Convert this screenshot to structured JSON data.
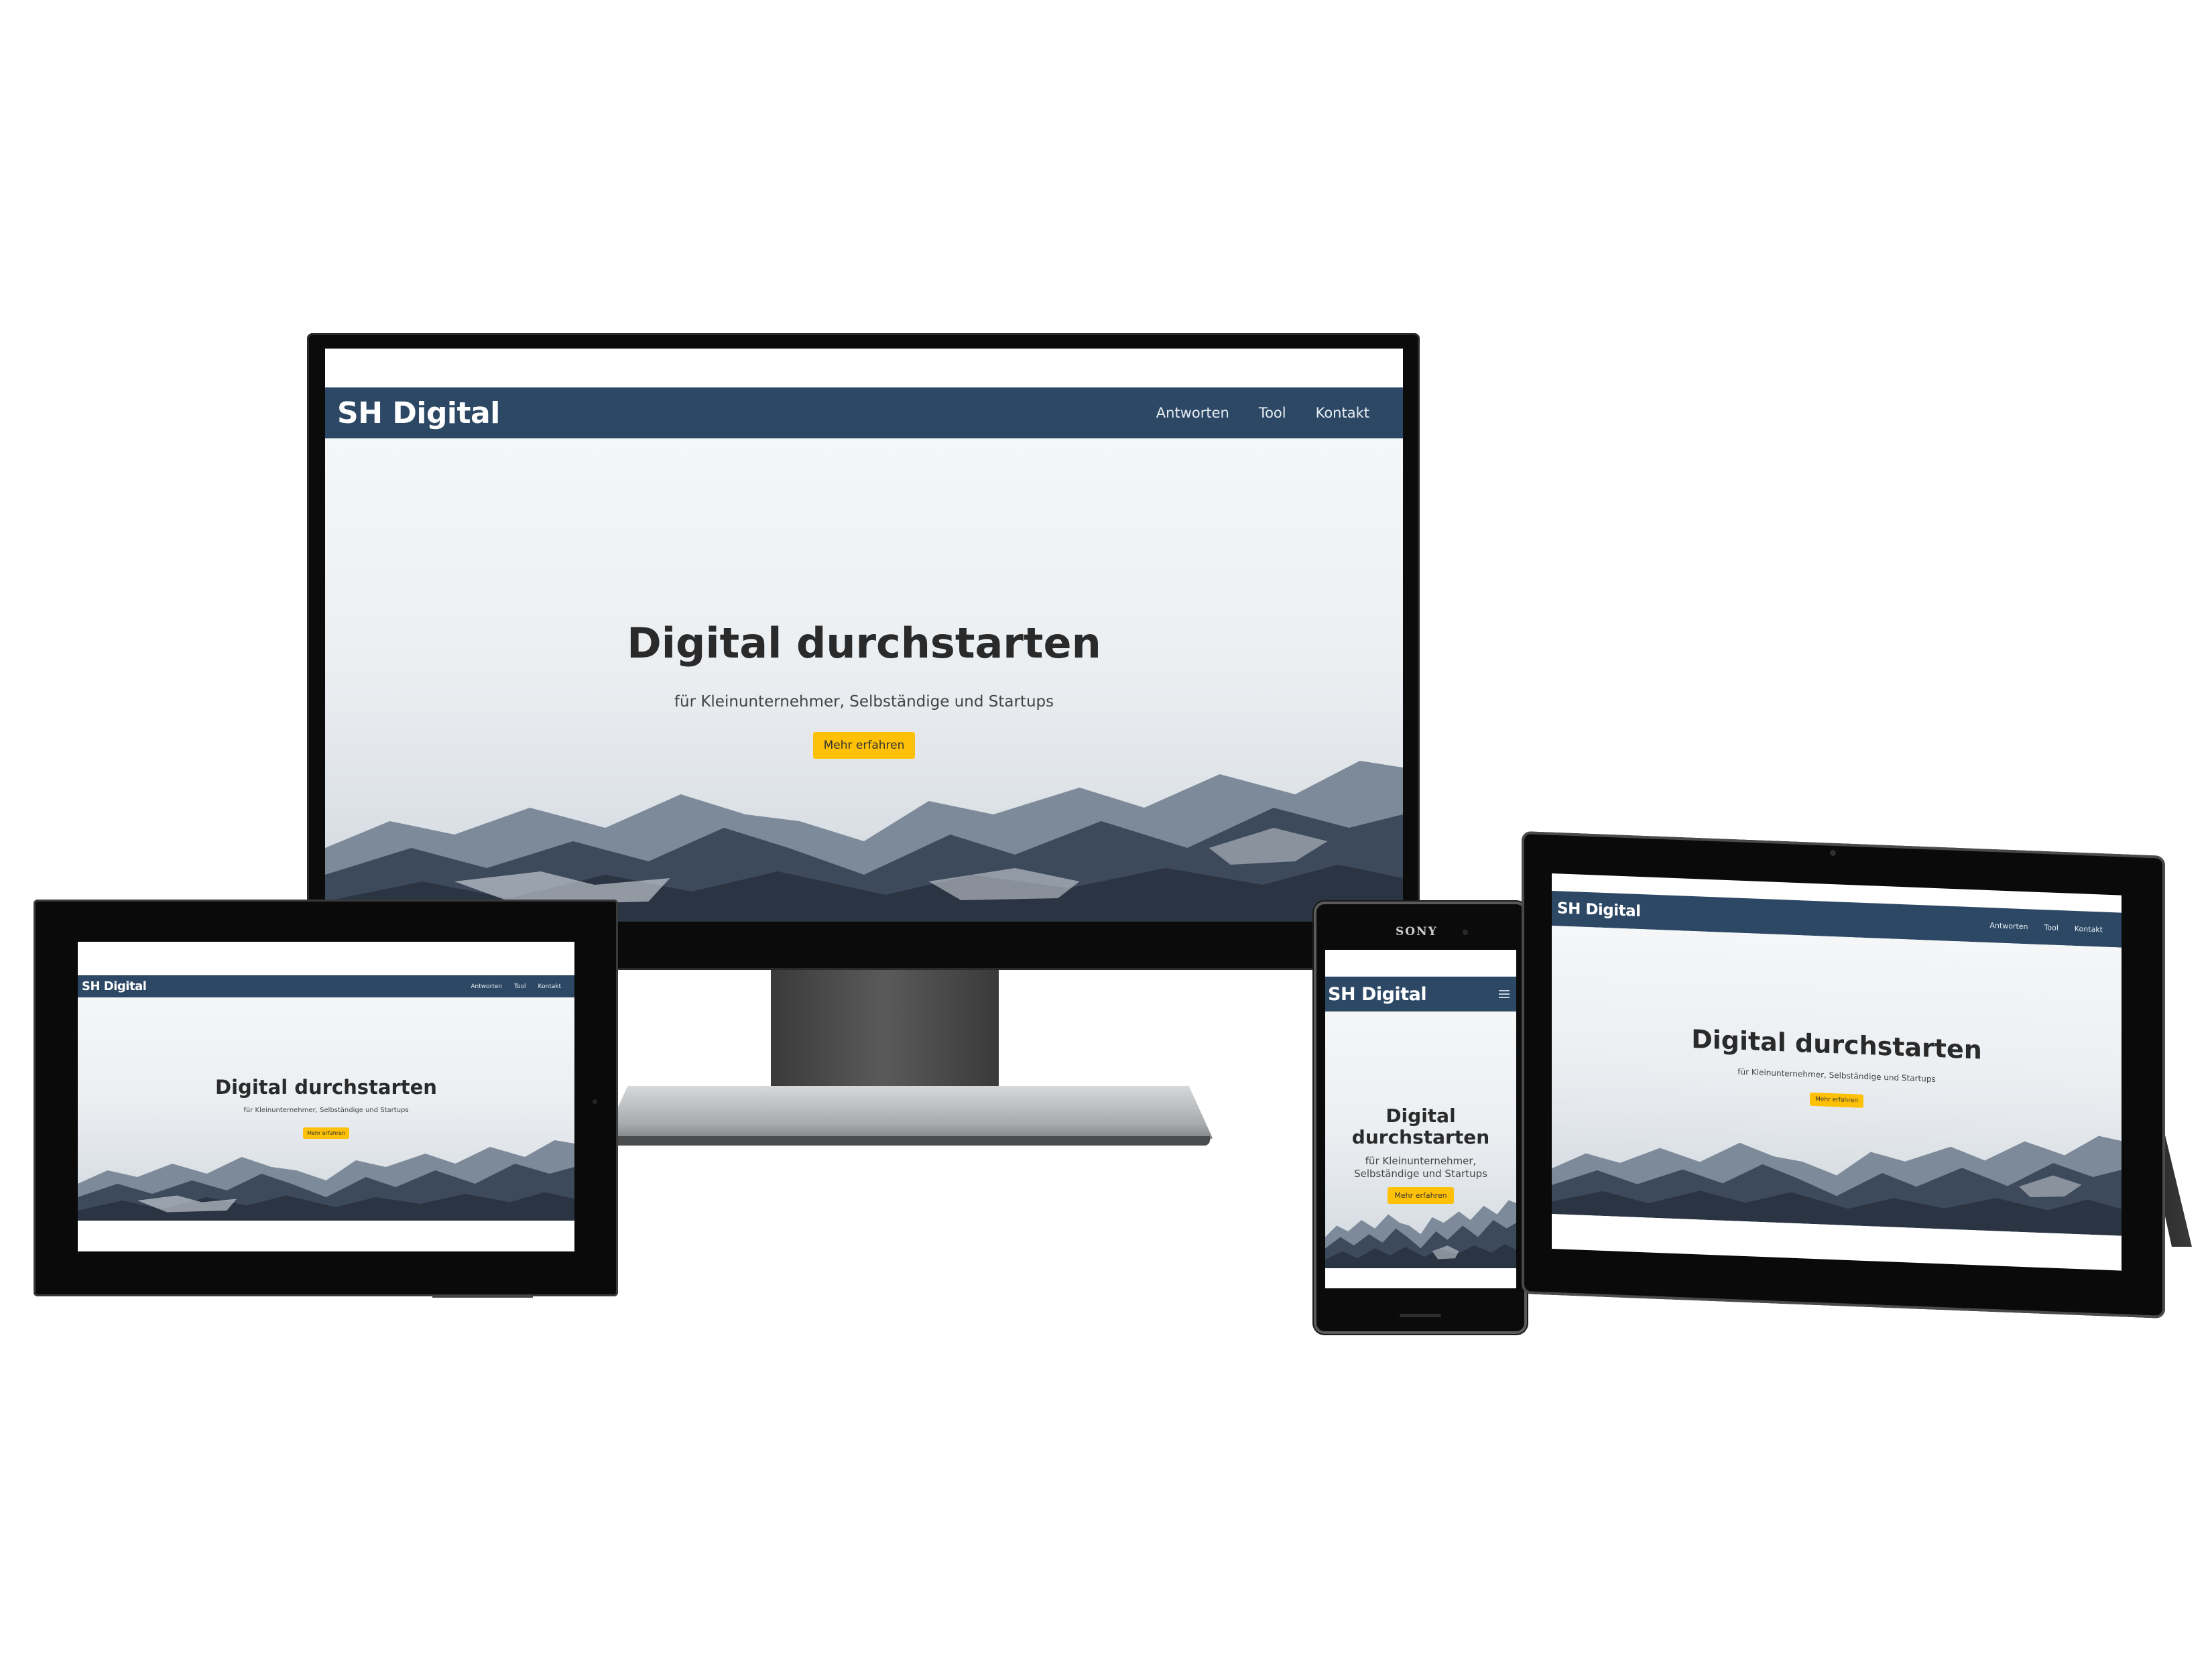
{
  "site": {
    "logo": "SH Digital",
    "nav": [
      "Antworten",
      "Tool",
      "Kontakt"
    ],
    "hero_title": "Digital durchstarten",
    "hero_subtitle": "für Kleinunternehmer, Selbständige und Startups",
    "cta_label": "Mehr erfahren",
    "mobile_hero_title": [
      "Digital",
      "durchstarten"
    ],
    "mobile_hero_subtitle": [
      "für Kleinunternehmer,",
      "Selbständige und Startups"
    ]
  },
  "phone": {
    "brand": "SONY"
  },
  "colors": {
    "nav_background": "#2c4864",
    "cta_background": "#ffc107",
    "device_bezel": "#0a0a0a"
  },
  "icons": {
    "mobile_menu": "hamburger-menu-icon",
    "windows": "windows-logo-icon"
  }
}
